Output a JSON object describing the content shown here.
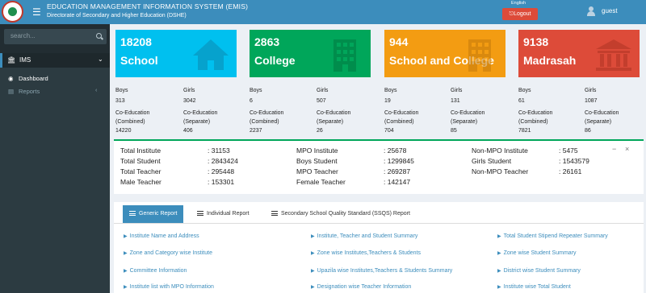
{
  "header": {
    "title": "EDUCATION MANAGEMENT INFORMATION SYSTEM (EMIS)",
    "subtitle": "Directorate of Secondary and Higher Education (DSHE)",
    "language": "English",
    "logout_label": "Logout",
    "username": "guest"
  },
  "sidebar": {
    "search_placeholder": "search...",
    "section": "IMS",
    "items": [
      {
        "label": "Dashboard",
        "icon": "dashboard-icon"
      },
      {
        "label": "Reports",
        "icon": "chart-icon"
      }
    ]
  },
  "boxes": [
    {
      "count": "18208",
      "label": "School",
      "color": "#00c0ef",
      "icon": "home-icon",
      "boys_label": "Boys",
      "girls_label": "Girls",
      "boys": "313",
      "girls": "3042",
      "coed_combined_label": "Co-Education (Combined)",
      "coed_separate_label": "Co-Education (Separate)",
      "coed_combined": "14220",
      "coed_separate": "406"
    },
    {
      "count": "2863",
      "label": "College",
      "color": "#00a65a",
      "icon": "building-icon",
      "boys_label": "Boys",
      "girls_label": "Girls",
      "boys": "6",
      "girls": "507",
      "coed_combined_label": "Co-Education (Combined)",
      "coed_separate_label": "Co-Education (Separate)",
      "coed_combined": "2237",
      "coed_separate": "26"
    },
    {
      "count": "944",
      "label": "School and College",
      "color": "#f39c12",
      "icon": "building-icon",
      "boys_label": "Boys",
      "girls_label": "Girls",
      "boys": "19",
      "girls": "131",
      "coed_combined_label": "Co-Education (Combined)",
      "coed_separate_label": "Co-Education (Separate)",
      "coed_combined": "704",
      "coed_separate": "85"
    },
    {
      "count": "9138",
      "label": "Madrasah",
      "color": "#dd4b39",
      "icon": "institution-icon",
      "boys_label": "Boys",
      "girls_label": "Girls",
      "boys": "61",
      "girls": "1087",
      "coed_combined_label": "Co-Education (Combined)",
      "coed_separate_label": "Co-Education (Separate)",
      "coed_combined": "7821",
      "coed_separate": "86"
    }
  ],
  "totals": {
    "col1": [
      {
        "label": "Total Institute",
        "value": ": 31153"
      },
      {
        "label": "Total Student",
        "value": ": 2843424"
      },
      {
        "label": "Total Teacher",
        "value": ": 295448"
      },
      {
        "label": "Male Teacher",
        "value": ": 153301"
      }
    ],
    "col2": [
      {
        "label": "MPO Institute",
        "value": ": 25678"
      },
      {
        "label": "Boys Student",
        "value": ": 1299845"
      },
      {
        "label": "MPO Teacher",
        "value": ": 269287"
      },
      {
        "label": "Female Teacher",
        "value": ": 142147"
      }
    ],
    "col3": [
      {
        "label": "Non-MPO Institute",
        "value": ": 5475"
      },
      {
        "label": "Girls Student",
        "value": ": 1543579"
      },
      {
        "label": "Non-MPO Teacher",
        "value": ": 26161"
      }
    ],
    "minimize": "−",
    "close": "×"
  },
  "tabs": [
    {
      "label": "Generic Report",
      "active": true
    },
    {
      "label": "Individual Report",
      "active": false
    },
    {
      "label": "Secondary School Quality Standard (SSQS) Report",
      "active": false
    }
  ],
  "links": {
    "col1": [
      "Institute Name and Address",
      "Zone and Category wise Institute",
      "Committee Information",
      "Institute list with MPO Information"
    ],
    "col2": [
      "Institute, Teacher and Student Summary",
      "Zone wise Institutes,Teachers & Students",
      "Upazila wise Institutes,Teachers & Students Summary",
      "Designation wise Teacher Information"
    ],
    "col3": [
      "Total Student Stipend Repeater Summary",
      "Zone wise Student Summary",
      "District wise Student Summary",
      "Institute wise Total Student"
    ]
  }
}
